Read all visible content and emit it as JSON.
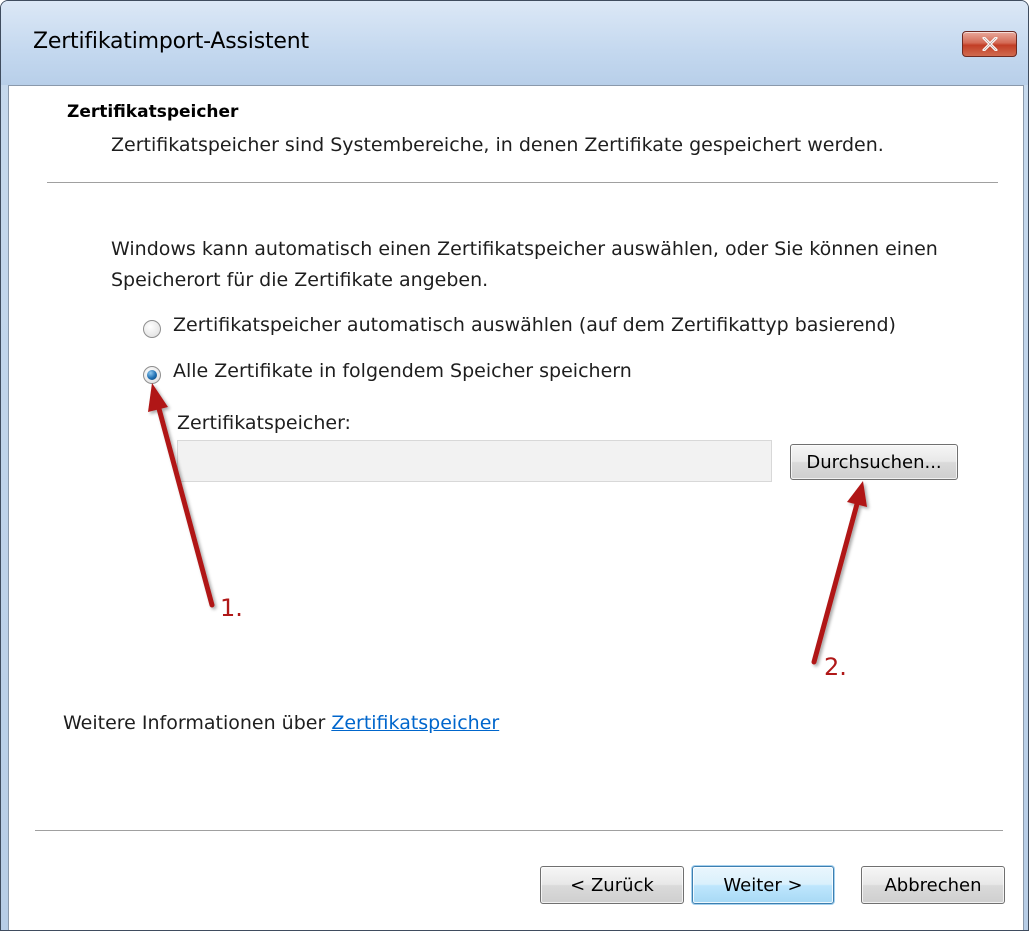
{
  "window": {
    "title": "Zertifikatimport-Assistent"
  },
  "header": {
    "title": "Zertifikatspeicher",
    "subtitle": "Zertifikatspeicher sind Systembereiche, in denen Zertifikate gespeichert werden."
  },
  "body": {
    "intro_line1": "Windows kann automatisch einen Zertifikatspeicher auswählen, oder Sie können einen",
    "intro_line2": "Speicherort für die Zertifikate angeben.",
    "options": [
      {
        "label": "Zertifikatspeicher automatisch auswählen (auf dem Zertifikattyp basierend)",
        "selected": false
      },
      {
        "label": "Alle Zertifikate in folgendem Speicher speichern",
        "selected": true
      }
    ],
    "store_label": "Zertifikatspeicher:",
    "store_value": "",
    "browse_button": "Durchsuchen..."
  },
  "info": {
    "prefix": "Weitere Informationen über ",
    "link": "Zertifikatspeicher"
  },
  "buttons": {
    "back": "< Zurück",
    "next": "Weiter >",
    "cancel": "Abbrechen"
  },
  "annotations": {
    "step1": "1.",
    "step2": "2.",
    "color": "#b01818"
  },
  "icons": {
    "close": "close-icon"
  }
}
